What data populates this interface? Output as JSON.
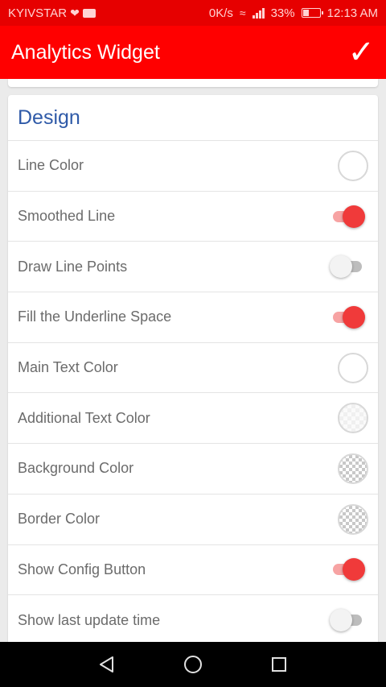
{
  "status_bar": {
    "carrier": "KYIVSTAR",
    "speed": "0K/s",
    "battery": "33%",
    "time": "12:13 AM"
  },
  "app_bar": {
    "title": "Analytics Widget",
    "confirm_icon": "check-icon"
  },
  "section": {
    "title": "Design",
    "rows": [
      {
        "label": "Line Color",
        "control": "color",
        "swatch": "white"
      },
      {
        "label": "Smoothed Line",
        "control": "toggle",
        "on": true
      },
      {
        "label": "Draw Line Points",
        "control": "toggle",
        "on": false
      },
      {
        "label": "Fill the Underline Space",
        "control": "toggle",
        "on": true
      },
      {
        "label": "Main Text Color",
        "control": "color",
        "swatch": "white"
      },
      {
        "label": "Additional Text Color",
        "control": "color",
        "swatch": "light-transparent"
      },
      {
        "label": "Background Color",
        "control": "color",
        "swatch": "transparent"
      },
      {
        "label": "Border Color",
        "control": "color",
        "swatch": "transparent"
      },
      {
        "label": "Show Config Button",
        "control": "toggle",
        "on": true
      },
      {
        "label": "Show last update time",
        "control": "toggle",
        "on": false
      }
    ]
  },
  "colors": {
    "status_bar": "#e60000",
    "app_bar": "#ff0000",
    "accent": "#f03a3a",
    "section_title": "#2f5aa8"
  },
  "nav_bar": {
    "back_icon": "back-triangle-icon",
    "home_icon": "home-circle-icon",
    "recents_icon": "recents-square-icon"
  }
}
